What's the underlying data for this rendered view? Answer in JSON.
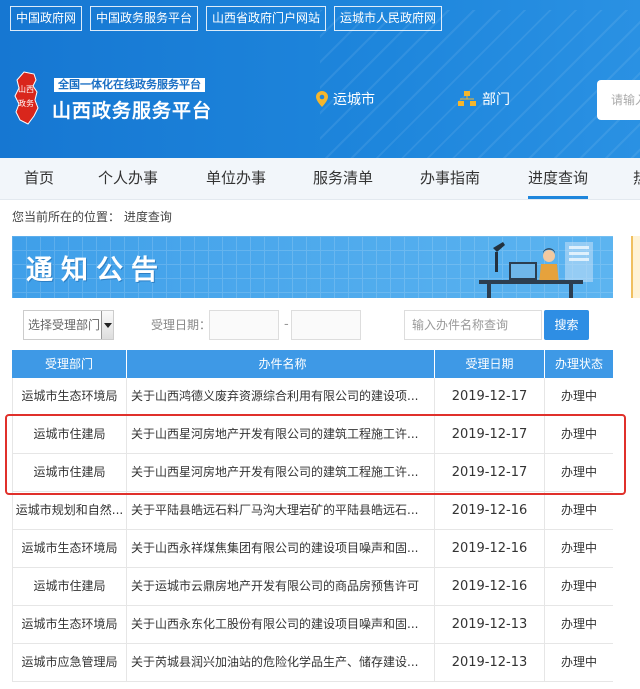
{
  "top_links": [
    "中国政府网",
    "中国政务服务平台",
    "山西省政府门户网站",
    "运城市人民政府网"
  ],
  "header": {
    "logo_text": "山西政务",
    "slogan": "全国一体化在线政务服务平台",
    "site_title": "山西政务服务平台",
    "location": "运城市",
    "department": "部门",
    "search_placeholder": "请输入"
  },
  "nav": [
    "首页",
    "个人办事",
    "单位办事",
    "服务清单",
    "办事指南",
    "进度查询",
    "热"
  ],
  "active_nav": "进度查询",
  "breadcrumb": {
    "prefix": "您当前所在的位置：",
    "current": "进度查询"
  },
  "banner": {
    "title": "通知公告"
  },
  "filter": {
    "dept_select": "选择受理部门",
    "date_label": "受理日期：",
    "date_sep": "-",
    "keyword_placeholder": "输入办件名称查询",
    "search_button": "搜索"
  },
  "table": {
    "headers": [
      "受理部门",
      "办件名称",
      "受理日期",
      "办理状态"
    ],
    "rows": [
      {
        "dept": "运城市生态环境局",
        "name": "关于山西鸿德义废弃资源综合利用有限公司的建设项...",
        "date": "2019-12-17",
        "status": "办理中"
      },
      {
        "dept": "运城市住建局",
        "name": "关于山西星河房地产开发有限公司的建筑工程施工许...",
        "date": "2019-12-17",
        "status": "办理中"
      },
      {
        "dept": "运城市住建局",
        "name": "关于山西星河房地产开发有限公司的建筑工程施工许...",
        "date": "2019-12-17",
        "status": "办理中"
      },
      {
        "dept": "运城市规划和自然...",
        "name": "关于平陆县皓远石料厂马沟大理岩矿的平陆县皓远石...",
        "date": "2019-12-16",
        "status": "办理中"
      },
      {
        "dept": "运城市生态环境局",
        "name": "关于山西永祥煤焦集团有限公司的建设项目噪声和固...",
        "date": "2019-12-16",
        "status": "办理中"
      },
      {
        "dept": "运城市住建局",
        "name": "关于运城市云鼎房地产开发有限公司的商品房预售许可",
        "date": "2019-12-16",
        "status": "办理中"
      },
      {
        "dept": "运城市生态环境局",
        "name": "关于山西永东化工股份有限公司的建设项目噪声和固...",
        "date": "2019-12-13",
        "status": "办理中"
      },
      {
        "dept": "运城市应急管理局",
        "name": "关于芮城县润兴加油站的危险化学品生产、储存建设...",
        "date": "2019-12-13",
        "status": "办理中"
      }
    ]
  },
  "colors": {
    "header_blue": "#1e86dc",
    "table_header": "#3e99e6",
    "search_button": "#2e8ee4",
    "highlight_red": "#e0302b"
  },
  "icons": [
    "location-pin-icon",
    "department-icon",
    "dropdown-arrow-icon",
    "office-worker-illustration"
  ]
}
